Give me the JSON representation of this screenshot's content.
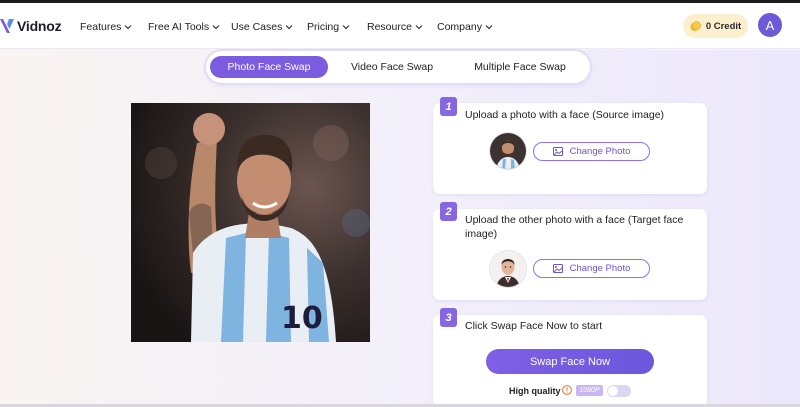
{
  "brand": {
    "name": "Vidnoz"
  },
  "nav": {
    "items": [
      {
        "label": "Features"
      },
      {
        "label": "Free AI Tools"
      },
      {
        "label": "Use Cases"
      },
      {
        "label": "Pricing"
      },
      {
        "label": "Resource"
      },
      {
        "label": "Company"
      }
    ]
  },
  "account": {
    "credit_label": "0 Credit",
    "avatar_initial": "A"
  },
  "tabs": [
    {
      "label": "Photo Face Swap",
      "active": true
    },
    {
      "label": "Video Face Swap",
      "active": false
    },
    {
      "label": "Multiple Face Swap",
      "active": false
    }
  ],
  "steps": [
    {
      "number": "1",
      "text": "Upload a photo with a face (Source image)",
      "button_label": "Change Photo"
    },
    {
      "number": "2",
      "text": "Upload the other photo with a face (Target face image)",
      "button_label": "Change Photo"
    },
    {
      "number": "3",
      "text": "Click Swap Face Now to start"
    }
  ],
  "swap": {
    "button_label": "Swap Face Now",
    "high_quality_label": "High quality",
    "quality_badge": "1080P",
    "high_quality_enabled": false
  },
  "colors": {
    "accent": "#7b5ce0",
    "credit_bg": "#fbefcd",
    "step_badge": "#8667e2"
  },
  "icons": {
    "info": "info-icon",
    "image": "image-icon",
    "coin": "coin-icon",
    "chevron": "chevron-down-icon"
  }
}
